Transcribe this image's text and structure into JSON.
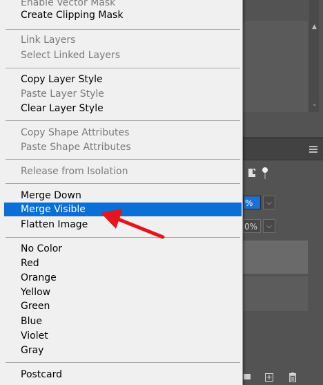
{
  "opacity_field": {
    "value": "%",
    "dropdown": "⌵"
  },
  "fill_field": {
    "value": "0%",
    "dropdown": "⌵"
  },
  "icons": {
    "panel_menu": "panel-menu-icon",
    "lock_doc": "lock-document-icon",
    "lock_pin": "lock-pin-icon",
    "new_group": "folder-icon",
    "new_layer": "new-layer-icon",
    "delete": "trash-icon"
  },
  "context_menu": {
    "items": {
      "enable_vector_mask": "Enable Vector Mask",
      "create_clipping_mask": "Create Clipping Mask",
      "link_layers": "Link Layers",
      "select_linked_layers": "Select Linked Layers",
      "copy_layer_style": "Copy Layer Style",
      "paste_layer_style": "Paste Layer Style",
      "clear_layer_style": "Clear Layer Style",
      "copy_shape_attributes": "Copy Shape Attributes",
      "paste_shape_attributes": "Paste Shape Attributes",
      "release_from_isolation": "Release from Isolation",
      "merge_down": "Merge Down",
      "merge_visible": "Merge Visible",
      "flatten_image": "Flatten Image",
      "no_color": "No Color",
      "red": "Red",
      "orange": "Orange",
      "yellow": "Yellow",
      "green": "Green",
      "blue": "Blue",
      "violet": "Violet",
      "gray": "Gray",
      "postcard": "Postcard"
    },
    "highlighted_item": "Merge Visible"
  },
  "colors": {
    "menu_bg": "#f0f0f0",
    "highlight": "#0a6fd6",
    "annotation_arrow": "#e8141b",
    "app_bg": "#535353"
  }
}
